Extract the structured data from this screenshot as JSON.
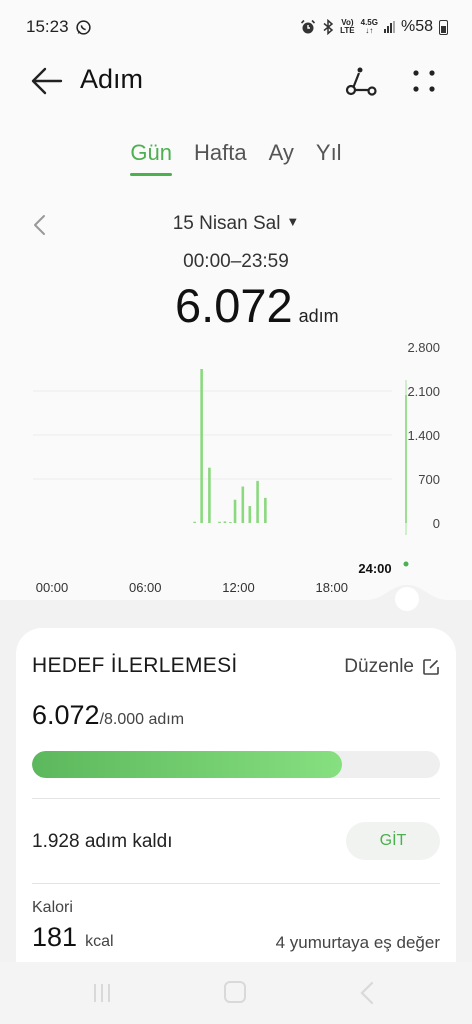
{
  "status": {
    "time": "15:23",
    "battery": "%58",
    "net_top": "Vo)",
    "net_bottom": "LTE",
    "gen_top": "4.5G",
    "gen_bottom": "↓↑"
  },
  "header": {
    "title": "Adım"
  },
  "tabs": [
    {
      "label": "Gün",
      "active": true
    },
    {
      "label": "Hafta",
      "active": false
    },
    {
      "label": "Ay",
      "active": false
    },
    {
      "label": "Yıl",
      "active": false
    }
  ],
  "date": {
    "label": "15 Nisan Sal",
    "range": "00:00–23:59"
  },
  "total": {
    "value": "6.072",
    "unit": "adım"
  },
  "chart_data": {
    "type": "bar",
    "x_unit": "hour",
    "x_ticks": [
      "00:00",
      "06:00",
      "12:00",
      "18:00"
    ],
    "x_end_label": "24:00",
    "y_ticks": [
      "2.800",
      "2.100",
      "1.400",
      "700",
      "0"
    ],
    "ylim": [
      0,
      2800
    ],
    "xlim": [
      0,
      24
    ],
    "bars": [
      {
        "x": 10.4,
        "value": 20
      },
      {
        "x": 10.85,
        "value": 2450
      },
      {
        "x": 11.35,
        "value": 880
      },
      {
        "x": 12.0,
        "value": 20
      },
      {
        "x": 12.35,
        "value": 25
      },
      {
        "x": 12.7,
        "value": 15
      },
      {
        "x": 13.0,
        "value": 370
      },
      {
        "x": 13.5,
        "value": 580
      },
      {
        "x": 13.95,
        "value": 270
      },
      {
        "x": 14.45,
        "value": 670
      },
      {
        "x": 14.95,
        "value": 400
      }
    ],
    "grid": true,
    "colors": {
      "bar": "#8bd97f",
      "grid": "#ececec",
      "axis_text": "#444"
    }
  },
  "goal": {
    "title": "HEDEF İLERLEMESİ",
    "edit_label": "Düzenle",
    "current": "6.072",
    "target": "/8.000 adım",
    "progress": 0.759,
    "remaining": "1.928 adım kaldı",
    "go_label": "GİT"
  },
  "calories": {
    "label": "Kalori",
    "value": "181",
    "unit": "kcal",
    "equivalent": "4 yumurtaya eş değer"
  },
  "colors": {
    "accent": "#4caf50"
  }
}
